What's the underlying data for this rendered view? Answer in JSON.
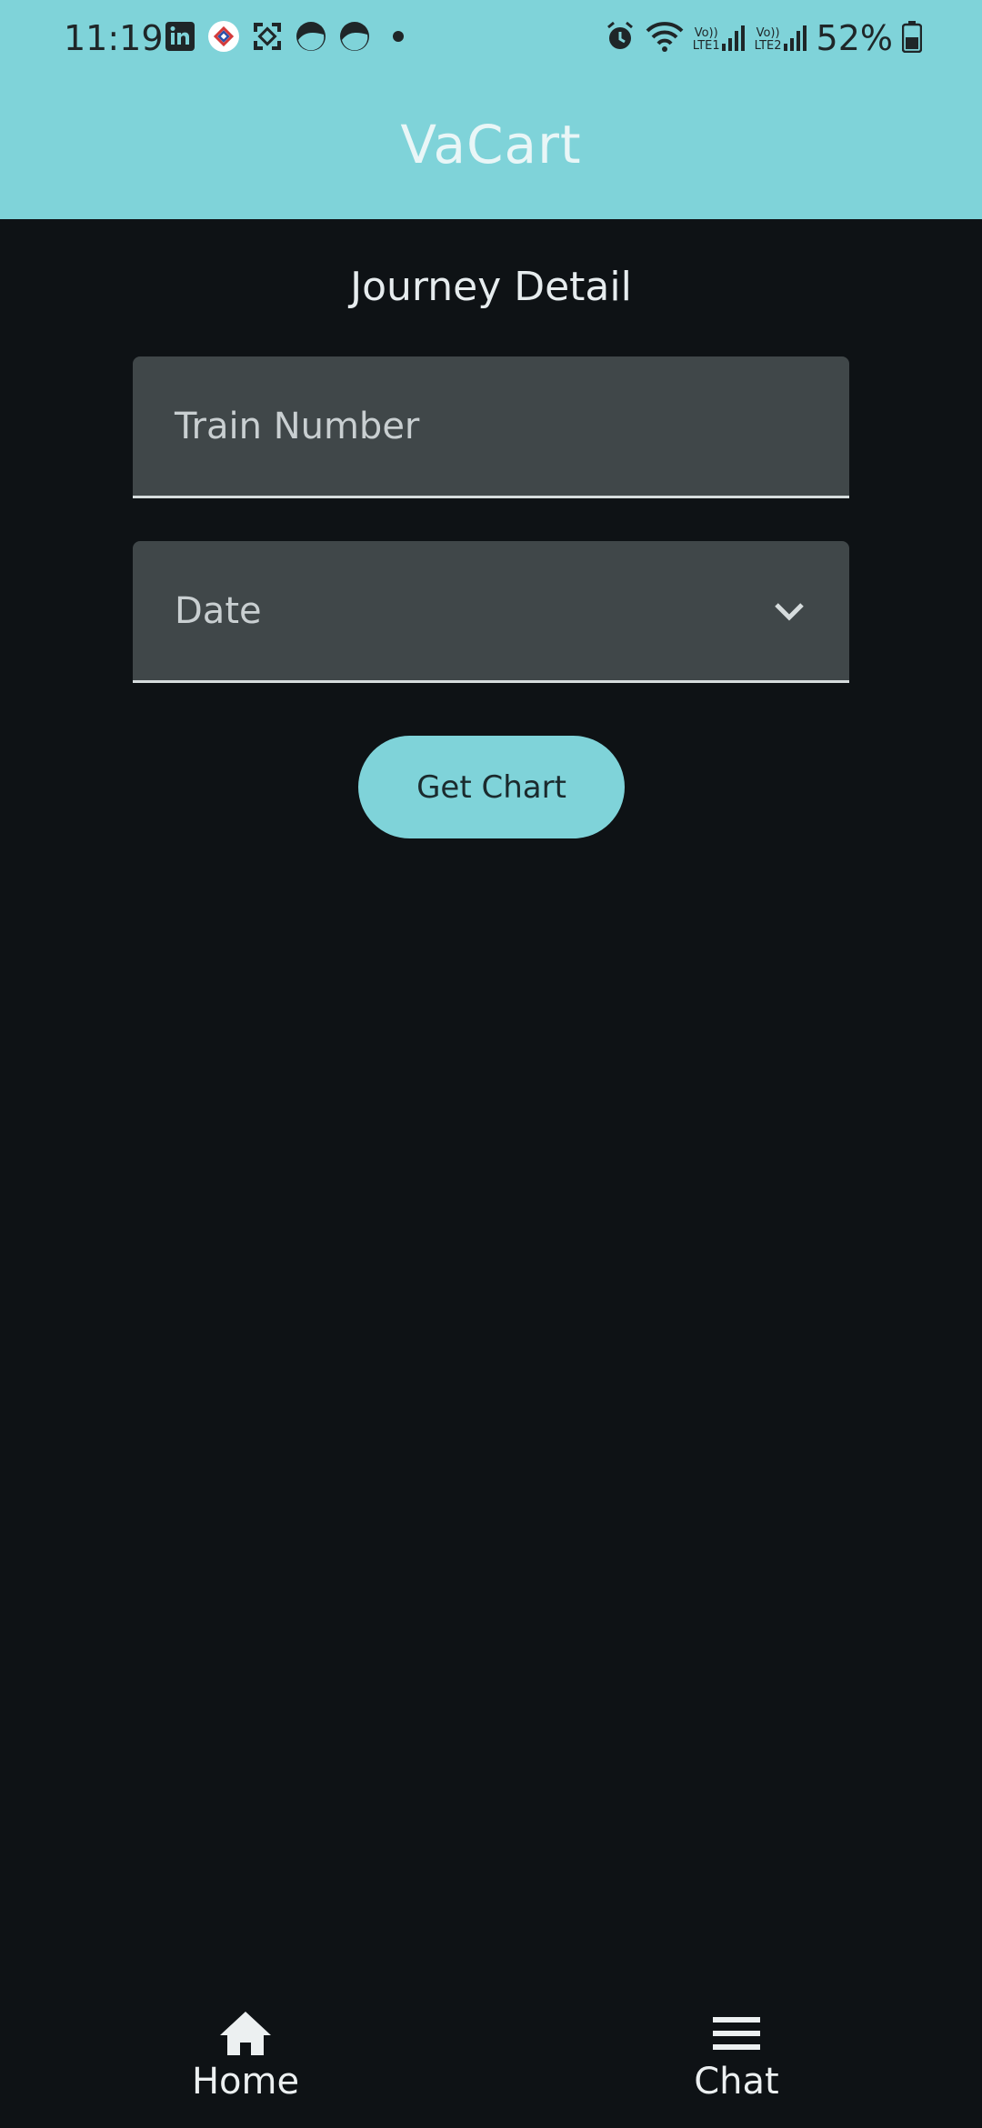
{
  "status_bar": {
    "time": "11:19",
    "battery": "52%",
    "notification_icons": [
      "linkedin-icon",
      "app-badge-icon",
      "scan-icon",
      "circle-half-icon",
      "circle-half-icon",
      "dot-icon"
    ],
    "system_icons": [
      "alarm-icon",
      "wifi-icon",
      "signal-lte1-icon",
      "signal-lte2-icon",
      "battery-icon"
    ],
    "lte1_label": "LTE1",
    "lte2_label": "LTE2",
    "volte_label": "Vo))"
  },
  "app_bar": {
    "title": "VaCart",
    "color": "#7fd3d9"
  },
  "journey": {
    "title": "Journey Detail",
    "train_number_placeholder": "Train Number",
    "date_placeholder": "Date",
    "get_chart_label": "Get Chart"
  },
  "bottom_nav": {
    "items": [
      {
        "label": "Home",
        "icon": "home-icon"
      },
      {
        "label": "Chat",
        "icon": "menu-icon"
      }
    ]
  },
  "colors": {
    "background": "#0e1215",
    "field": "#404749",
    "accent": "#7fd3d9"
  }
}
